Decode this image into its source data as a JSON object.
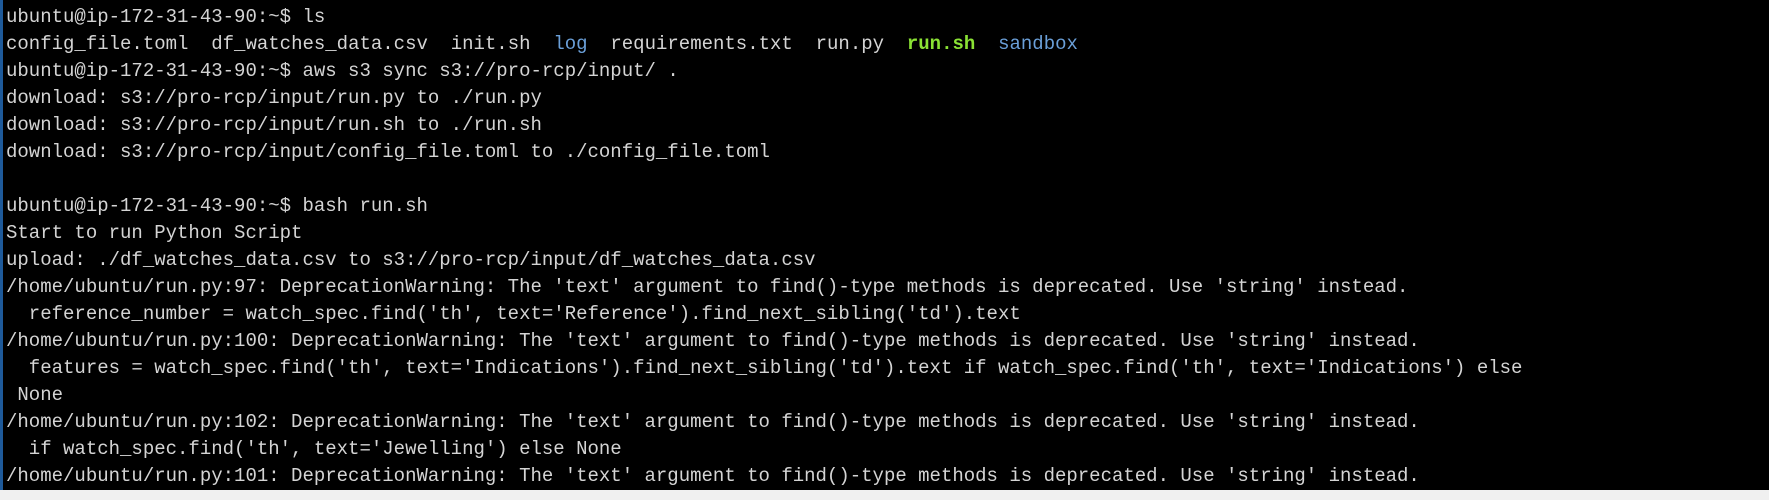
{
  "prompt": "ubuntu@ip-172-31-43-90:~$ ",
  "colors": {
    "directory": "#6a9fd8",
    "executable": "#8ae234",
    "text": "#d4d4d4",
    "background": "#000000"
  },
  "commands": {
    "ls": "ls",
    "sync": "aws s3 sync s3://pro-rcp/input/ .",
    "run": "bash run.sh"
  },
  "ls_output": {
    "f1": "config_file.toml",
    "f2": "df_watches_data.csv",
    "f3": "init.sh",
    "d1": "log",
    "f4": "requirements.txt",
    "f5": "run.py",
    "x1": "run.sh",
    "d2": "sandbox"
  },
  "output": [
    "download: s3://pro-rcp/input/run.py to ./run.py",
    "download: s3://pro-rcp/input/run.sh to ./run.sh",
    "download: s3://pro-rcp/input/config_file.toml to ./config_file.toml",
    "",
    "Start to run Python Script",
    "upload: ./df_watches_data.csv to s3://pro-rcp/input/df_watches_data.csv",
    "/home/ubuntu/run.py:97: DeprecationWarning: The 'text' argument to find()-type methods is deprecated. Use 'string' instead.",
    "  reference_number = watch_spec.find('th', text='Reference').find_next_sibling('td').text",
    "/home/ubuntu/run.py:100: DeprecationWarning: The 'text' argument to find()-type methods is deprecated. Use 'string' instead.",
    "  features = watch_spec.find('th', text='Indications').find_next_sibling('td').text if watch_spec.find('th', text='Indications') else",
    " None",
    "/home/ubuntu/run.py:102: DeprecationWarning: The 'text' argument to find()-type methods is deprecated. Use 'string' instead.",
    "  if watch_spec.find('th', text='Jewelling') else None",
    "/home/ubuntu/run.py:101: DeprecationWarning: The 'text' argument to find()-type methods is deprecated. Use 'string' instead."
  ]
}
